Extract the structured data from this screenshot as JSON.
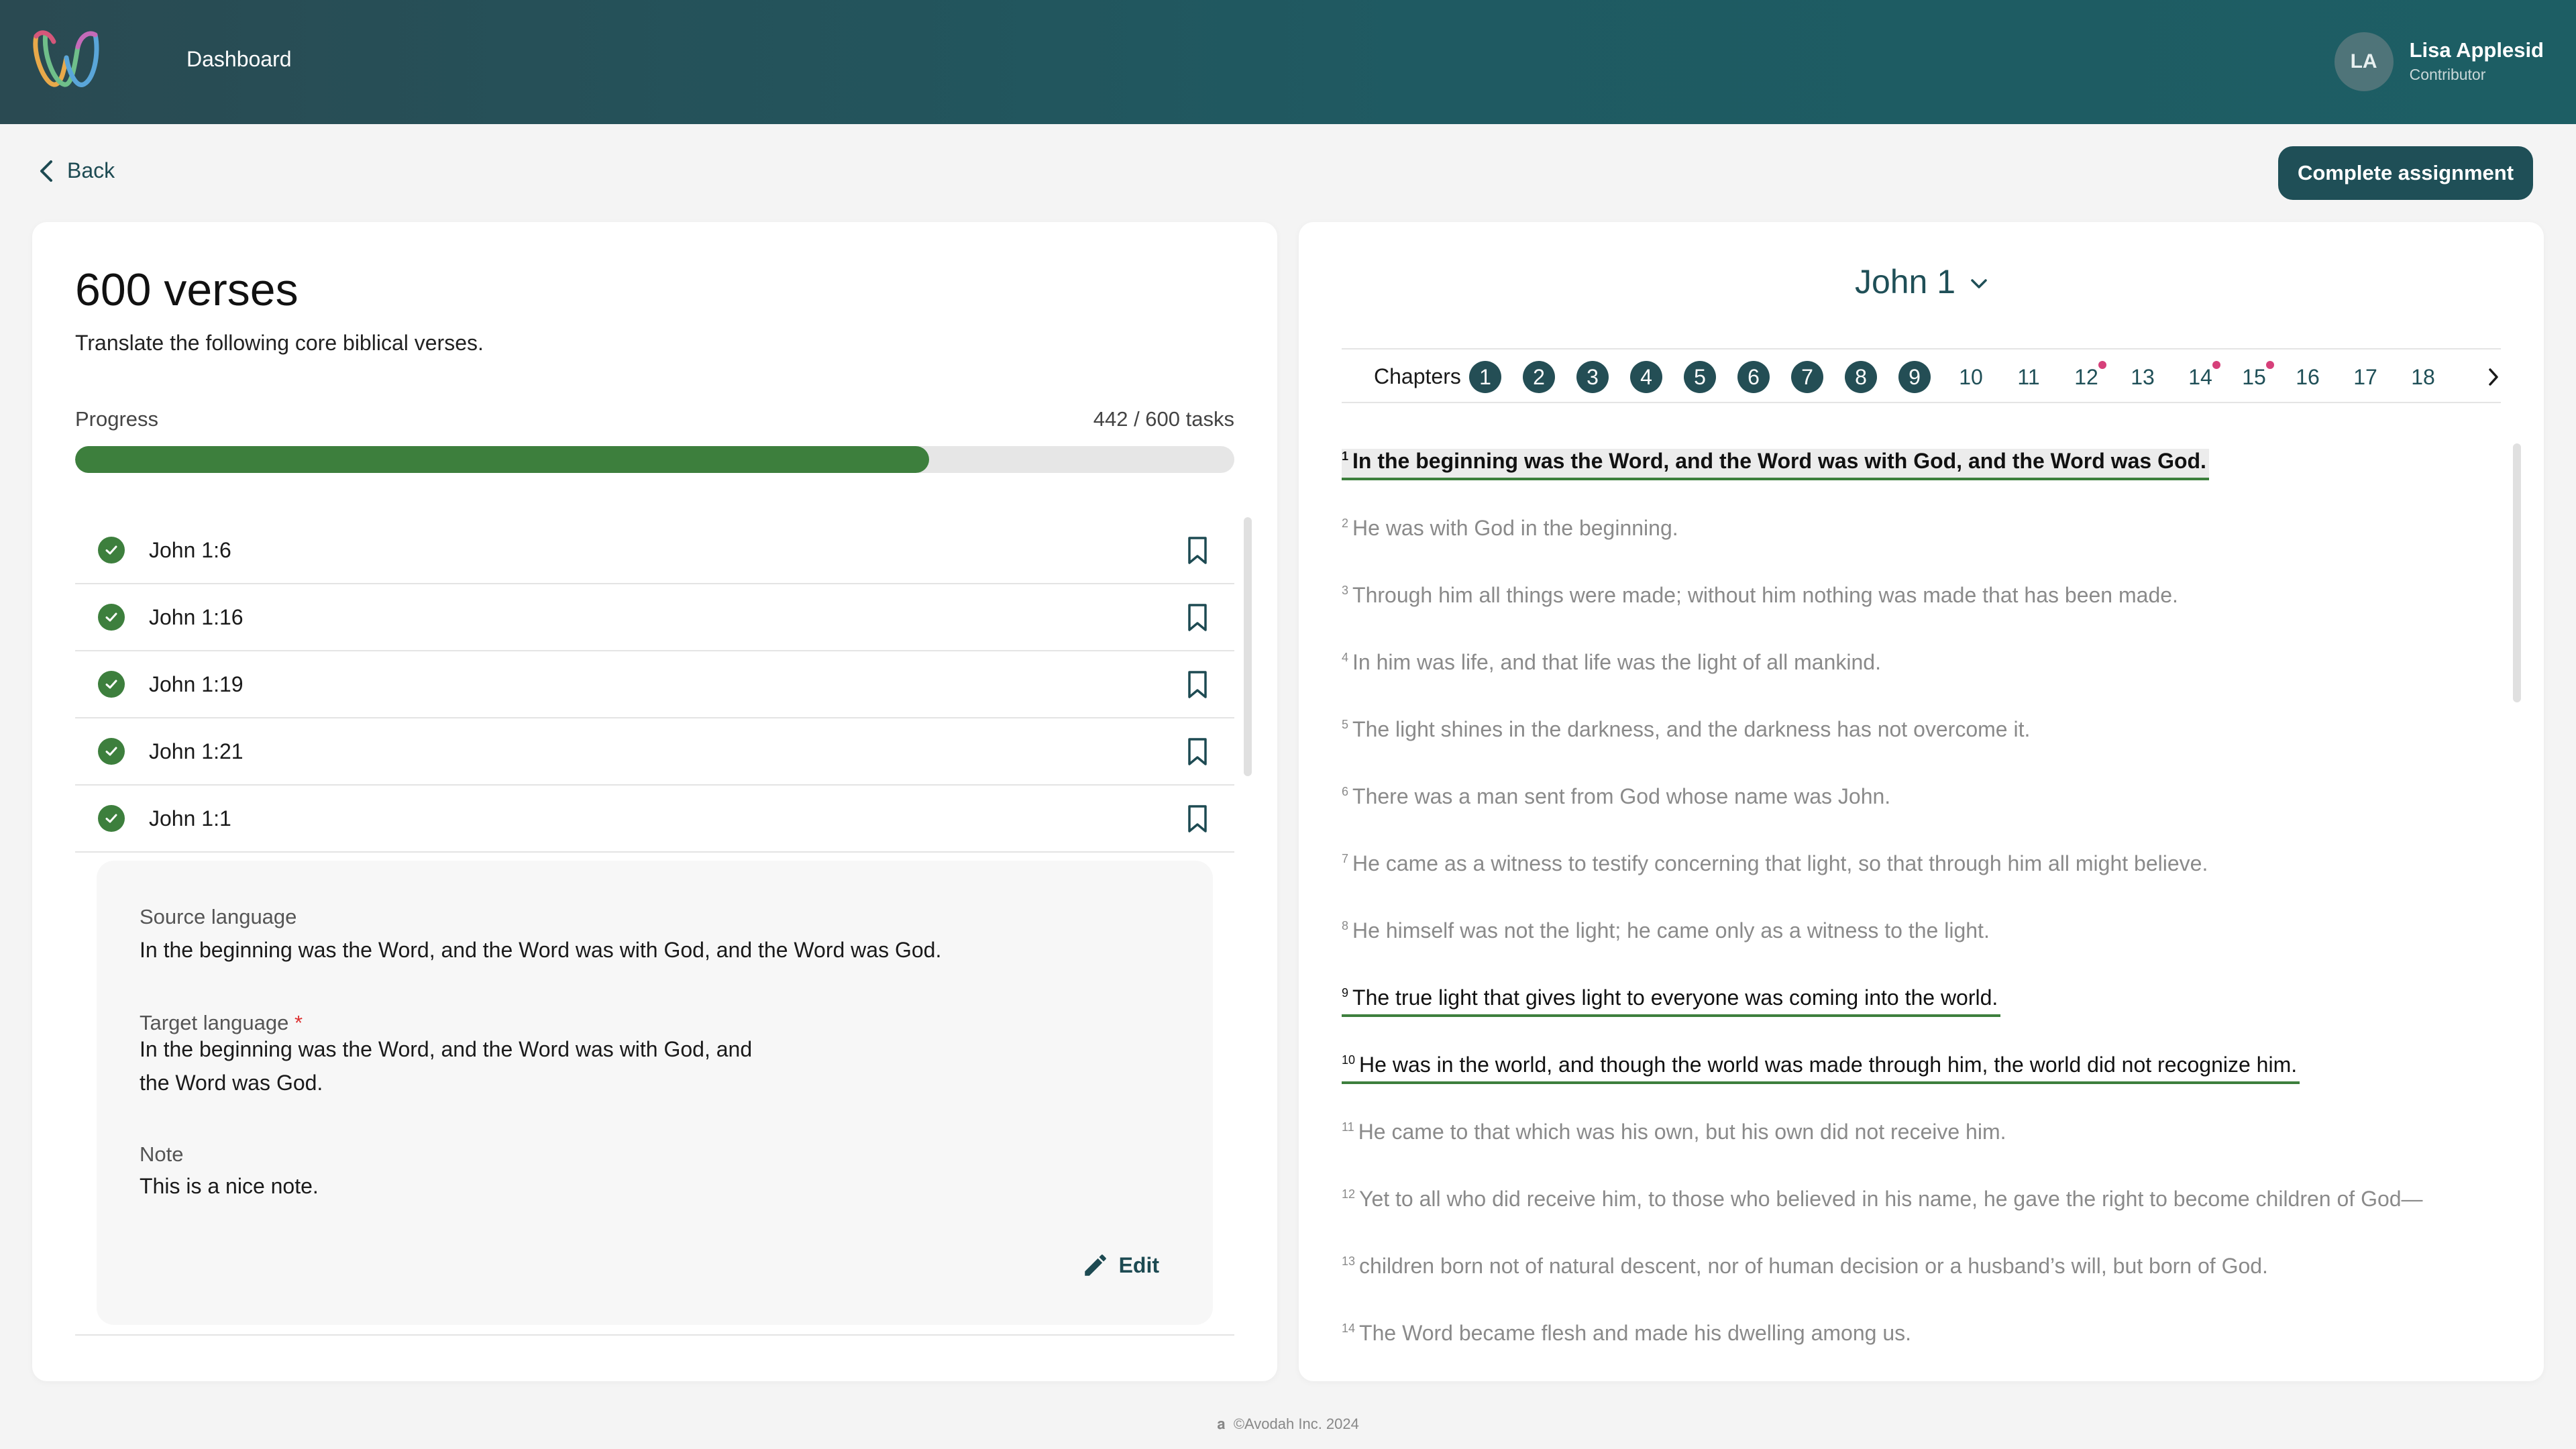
{
  "header": {
    "nav_label": "Dashboard",
    "user": {
      "initials": "LA",
      "name": "Lisa Applesid",
      "role": "Contributor"
    }
  },
  "toolbar": {
    "back_label": "Back",
    "complete_label": "Complete assignment"
  },
  "assignment": {
    "title": "600 verses",
    "subtitle": "Translate the following core biblical verses.",
    "progress_label": "Progress",
    "progress_count": "442 / 600 tasks",
    "progress_fraction": 0.7367,
    "accent_color": "#3d7f3d"
  },
  "verse_list": [
    {
      "ref": "John 1:6",
      "status": "completed",
      "icon": "check-icon"
    },
    {
      "ref": "John 1:16",
      "status": "completed",
      "icon": "check-icon"
    },
    {
      "ref": "John 1:19",
      "status": "completed",
      "icon": "check-icon"
    },
    {
      "ref": "John 1:21",
      "status": "completed",
      "icon": "check-icon"
    },
    {
      "ref": "John 1:1",
      "status": "completed",
      "icon": "check-icon",
      "expanded": true
    }
  ],
  "detail": {
    "source_label": "Source language",
    "source_text": "In the beginning was the Word, and the Word was with God, and the Word was God.",
    "target_label": "Target language",
    "target_required": "*",
    "target_line1": "In the beginning was the Word, and the Word was with God, and",
    "target_line2": "the Word was God.",
    "note_label": "Note",
    "note_text": "This is a nice note.",
    "edit_label": "Edit"
  },
  "reader": {
    "book_label": "John 1",
    "chapters_label": "Chapters",
    "chapters": [
      {
        "n": "1",
        "done": true,
        "flag": false
      },
      {
        "n": "2",
        "done": true,
        "flag": false
      },
      {
        "n": "3",
        "done": true,
        "flag": false
      },
      {
        "n": "4",
        "done": true,
        "flag": false
      },
      {
        "n": "5",
        "done": true,
        "flag": false
      },
      {
        "n": "6",
        "done": true,
        "flag": false
      },
      {
        "n": "7",
        "done": true,
        "flag": false
      },
      {
        "n": "8",
        "done": true,
        "flag": false
      },
      {
        "n": "9",
        "done": true,
        "flag": false
      },
      {
        "n": "10",
        "done": false,
        "flag": false
      },
      {
        "n": "11",
        "done": false,
        "flag": false
      },
      {
        "n": "12",
        "done": false,
        "flag": true
      },
      {
        "n": "13",
        "done": false,
        "flag": false
      },
      {
        "n": "14",
        "done": false,
        "flag": true
      },
      {
        "n": "15",
        "done": false,
        "flag": true
      },
      {
        "n": "16",
        "done": false,
        "flag": false
      },
      {
        "n": "17",
        "done": false,
        "flag": false
      },
      {
        "n": "18",
        "done": false,
        "flag": false
      }
    ],
    "flag_color": "#d6407a",
    "verses": [
      {
        "num": "1",
        "text": "In the beginning was the Word, and the Word was with God, and the Word was God.",
        "state": "active"
      },
      {
        "num": "2",
        "text": "He was with God in the beginning.",
        "state": "pending"
      },
      {
        "num": "3",
        "text": "Through him all things were made; without him nothing was made that has been made.",
        "state": "pending"
      },
      {
        "num": "4",
        "text": "In him was life, and that life was the light of all mankind.",
        "state": "pending"
      },
      {
        "num": "5",
        "text": "The light shines in the darkness, and the darkness has not overcome it.",
        "state": "pending"
      },
      {
        "num": "6",
        "text": "There was a man sent from God whose name was John.",
        "state": "pending"
      },
      {
        "num": "7",
        "text": "He came as a witness to testify concerning that light, so that through him all might believe.",
        "state": "pending"
      },
      {
        "num": "8",
        "text": "He himself was not the light; he came only as a witness to the light.",
        "state": "pending"
      },
      {
        "num": "9",
        "text": "The true light that gives light to everyone was coming into the world.",
        "state": "done"
      },
      {
        "num": "10",
        "text": "He was in the world, and though the world was made through him, the world did not recognize him.",
        "state": "done"
      },
      {
        "num": "11",
        "text": "He came to that which was his own, but his own did not receive him.",
        "state": "pending"
      },
      {
        "num": "12",
        "text": "Yet to all who did receive him, to those who believed in his name, he gave the right to become children of God—",
        "state": "pending"
      },
      {
        "num": "13",
        "text": "children born not of natural descent, nor of human decision or a husband’s will, but born of God.",
        "state": "pending"
      },
      {
        "num": "14",
        "text": "The Word became flesh and made his dwelling among us.",
        "state": "pending"
      }
    ]
  },
  "footer": {
    "copyright": "©Avodah Inc. 2024"
  }
}
